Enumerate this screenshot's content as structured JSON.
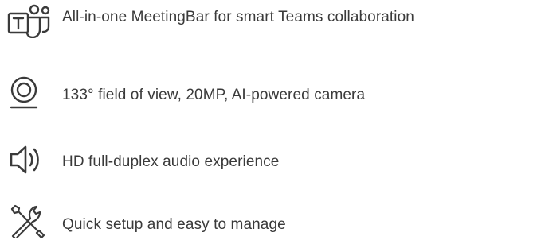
{
  "features": [
    {
      "icon": "teams-icon",
      "label": "All-in-one MeetingBar for smart Teams collaboration"
    },
    {
      "icon": "camera-icon",
      "label": "133° field of view, 20MP, AI-powered camera"
    },
    {
      "icon": "speaker-icon",
      "label": "HD full-duplex audio experience"
    },
    {
      "icon": "tools-icon",
      "label": "Quick setup and easy to manage"
    }
  ],
  "colors": {
    "text": "#3a3a3a",
    "icon": "#3a3a3a",
    "background": "#ffffff"
  }
}
